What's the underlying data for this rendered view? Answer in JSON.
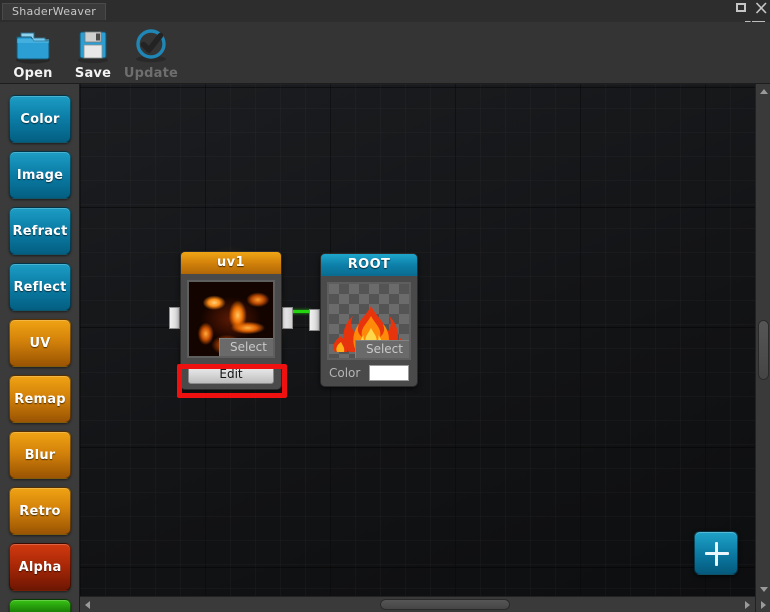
{
  "window": {
    "tab_title": "ShaderWeaver",
    "controls": [
      {
        "name": "restore-button",
        "icon": "restore-icon"
      },
      {
        "name": "close-button",
        "icon": "close-icon"
      }
    ],
    "menu_icon": "hamburger-menu-icon"
  },
  "toolbar": {
    "items": [
      {
        "label": "Open",
        "icon": "folder-open-icon",
        "disabled": false
      },
      {
        "label": "Save",
        "icon": "floppy-disk-icon",
        "disabled": false
      },
      {
        "label": "Update",
        "icon": "check-circle-icon",
        "disabled": true
      }
    ]
  },
  "sidebar": {
    "items": [
      {
        "label": "Color",
        "color": "#0c7fa8",
        "style": "blue"
      },
      {
        "label": "Image",
        "color": "#0c7fa8",
        "style": "blue"
      },
      {
        "label": "Refract",
        "color": "#0c7fa8",
        "style": "blue"
      },
      {
        "label": "Reflect",
        "color": "#0c7fa8",
        "style": "blue"
      },
      {
        "label": "UV",
        "color": "#d3820a",
        "style": "orange"
      },
      {
        "label": "Remap",
        "color": "#d3820a",
        "style": "orange"
      },
      {
        "label": "Blur",
        "color": "#d3820a",
        "style": "orange"
      },
      {
        "label": "Retro",
        "color": "#d3820a",
        "style": "orange"
      },
      {
        "label": "Alpha",
        "color": "#a82706",
        "style": "red"
      },
      {
        "label": "",
        "color": "#22920a",
        "style": "green"
      }
    ]
  },
  "canvas": {
    "nodes": [
      {
        "id": "uv1",
        "title": "uv1",
        "title_color": "#d2820b",
        "selected": true,
        "preview": "fire-noise-texture",
        "select_label": "Select",
        "edit_label": "Edit",
        "highlighted_control": "edit-button"
      },
      {
        "id": "root",
        "title": "ROOT",
        "title_color": "#0d80a9",
        "selected": false,
        "preview": "fire-on-transparent",
        "select_label": "Select",
        "color_label": "Color",
        "color_value": "#ffffff"
      }
    ],
    "connection": {
      "from": "uv1",
      "to": "root",
      "wire_color": "#25d411"
    },
    "add_button_label": "+"
  },
  "scrollbars": {
    "vertical": {
      "up_arrow": "scroll-up-arrow",
      "down_arrow": "scroll-down-arrow"
    },
    "horizontal": {
      "left_arrow": "scroll-left-arrow",
      "right_arrow": "scroll-right-arrow"
    }
  }
}
